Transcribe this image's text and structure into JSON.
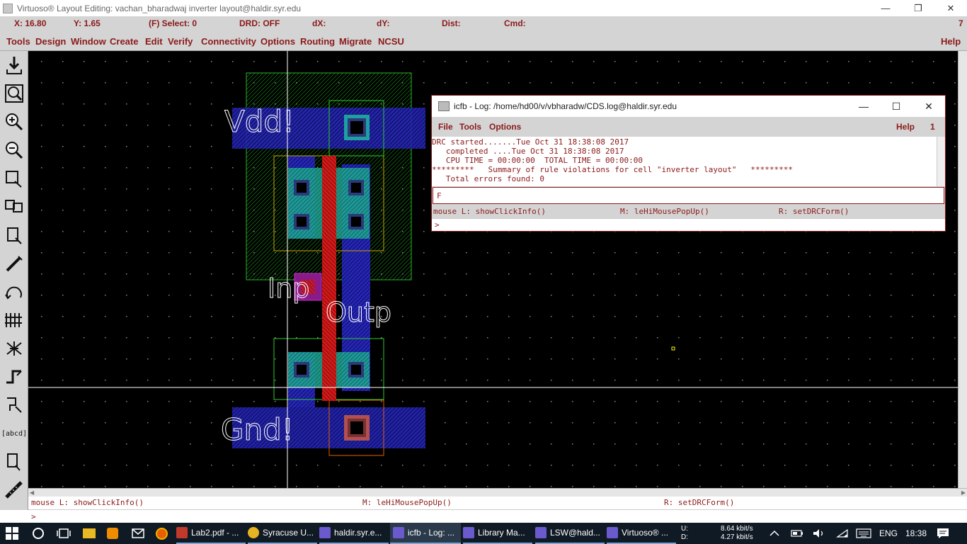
{
  "window": {
    "title": "Virtuoso® Layout Editing: vachan_bharadwaj inverter layout@haldir.syr.edu",
    "controls": [
      "—",
      "❐",
      "✕"
    ]
  },
  "coords": {
    "x": "X: 16.80",
    "y": "Y: 1.65",
    "select": "(F) Select: 0",
    "drd": "DRD: OFF",
    "dx": "dX:",
    "dy": "dY:",
    "dist": "Dist:",
    "cmd": "Cmd:",
    "num": "7"
  },
  "menu": {
    "items": [
      "Tools",
      "Design",
      "Window",
      "Create",
      "Edit",
      "Verify",
      "Connectivity",
      "Options",
      "Routing",
      "Migrate",
      "NCSU"
    ],
    "help": "Help"
  },
  "toolbar": {
    "icons": [
      "save-icon",
      "fit-view-icon",
      "zoom-in-icon",
      "zoom-out-icon",
      "stretch-icon",
      "copy-icon",
      "move-icon",
      "delete-icon",
      "undo-icon",
      "properties-icon",
      "instance-icon",
      "path-icon",
      "polygon-icon",
      "label-icon",
      "rectangle-icon",
      "ruler-icon"
    ],
    "label_icon_text": "[abcd]"
  },
  "layout": {
    "labels": {
      "vdd": "Vdd!",
      "inp": "Inp",
      "outp": "Outp",
      "gnd": "Gnd!"
    },
    "colors": {
      "background": "#000000",
      "nwell": "#1f9f1f",
      "metal1": "#2828c8",
      "poly": "#e01010",
      "active": "#1fa0a0",
      "select": "#c8a000",
      "contact": "#000000",
      "cursor": "#ffffff"
    }
  },
  "log_window": {
    "title": "icfb - Log: /home/hd00/v/vbharadw/CDS.log@haldir.syr.edu",
    "menu": [
      "File",
      "Tools",
      "Options"
    ],
    "help": "Help",
    "num": "1",
    "output_lines": [
      "DRC started.......Tue Oct 31 18:38:08 2017",
      "   completed ....Tue Oct 31 18:38:08 2017",
      "   CPU TIME = 00:00:00  TOTAL TIME = 00:00:00",
      "*********   Summary of rule violations for cell \"inverter layout\"   *********",
      "   Total errors found: 0"
    ],
    "input": "F",
    "mouse_l": "mouse L: showClickInfo()",
    "mouse_m": "M: leHiMousePopUp()",
    "mouse_r": "R: setDRCForm()",
    "prompt": ">"
  },
  "status": {
    "mouse_l": "mouse L: showClickInfo()",
    "mouse_m": "M: leHiMousePopUp()",
    "mouse_r": "R: setDRCForm()",
    "prompt": ">"
  },
  "taskbar": {
    "items": [
      {
        "label": "Lab2.pdf - ...",
        "icon": "pdf-icon",
        "color": "#c0392b",
        "state": "open"
      },
      {
        "label": "Syracuse U...",
        "icon": "chrome-icon",
        "color": "#e6b422",
        "state": "open"
      },
      {
        "label": "haldir.syr.e...",
        "icon": "xwin-icon",
        "color": "#6a5acd",
        "state": "open"
      },
      {
        "label": "icfb - Log: ...",
        "icon": "xwin-icon",
        "color": "#6a5acd",
        "state": "active"
      },
      {
        "label": "Library Ma...",
        "icon": "xwin-icon",
        "color": "#6a5acd",
        "state": "open"
      },
      {
        "label": "LSW@hald...",
        "icon": "xwin-icon",
        "color": "#6a5acd",
        "state": "open"
      },
      {
        "label": "Virtuoso® ...",
        "icon": "xwin-icon",
        "color": "#6a5acd",
        "state": "open"
      }
    ],
    "net_up_label": "U:",
    "net_down_label": "D:",
    "net_up": "8.64 kbit/s",
    "net_down": "4.27 kbit/s",
    "language": "ENG",
    "time": "18:38"
  }
}
